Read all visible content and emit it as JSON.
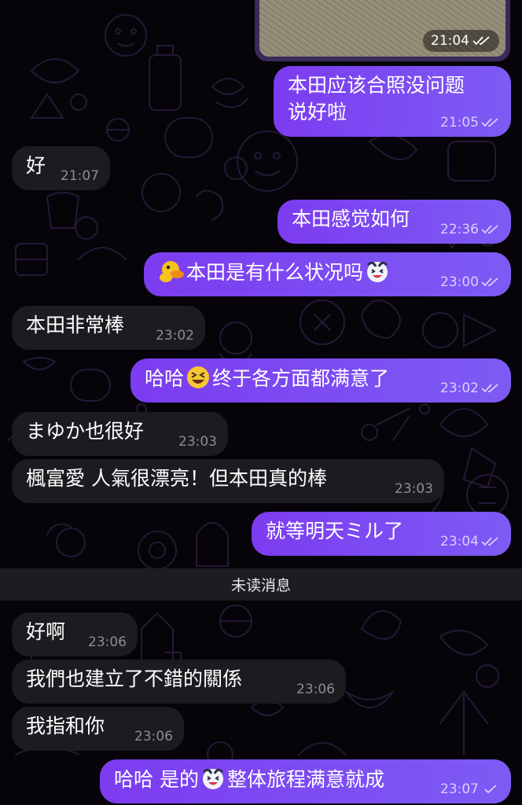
{
  "chat": {
    "photo_time": "21:04",
    "unread_divider": "未读消息",
    "messages": [
      {
        "id": "m1",
        "dir": "out",
        "lines": [
          "本田应该合照没问题",
          "说好啦"
        ],
        "time": "21:05",
        "status": "read"
      },
      {
        "id": "m2",
        "dir": "in",
        "text": "好",
        "time": "21:07"
      },
      {
        "id": "m3",
        "dir": "out",
        "text": "本田感觉如何",
        "time": "22:36",
        "status": "read"
      },
      {
        "id": "m4",
        "dir": "out",
        "emoji_start": "duck-emoji",
        "text": "本田是有什么状况吗",
        "emoji_end": "laughing-face-emoji",
        "time": "23:00",
        "status": "read"
      },
      {
        "id": "m5",
        "dir": "in",
        "text": "本田非常棒",
        "time": "23:02"
      },
      {
        "id": "m6",
        "dir": "out",
        "text_before": "哈哈",
        "emoji_mid": "grinning-squinting-face-emoji",
        "text_after": "终于各方面都满意了",
        "time": "23:02",
        "status": "read"
      },
      {
        "id": "m7",
        "dir": "in",
        "text": "まゆか也很好",
        "time": "23:03"
      },
      {
        "id": "m8",
        "dir": "in",
        "text": "楓富愛 人氣很漂亮！但本田真的棒",
        "time": "23:03"
      },
      {
        "id": "m9",
        "dir": "out",
        "text": "就等明天ミル了",
        "time": "23:04",
        "status": "read"
      },
      {
        "id": "m10",
        "dir": "in",
        "text": "好啊",
        "time": "23:06"
      },
      {
        "id": "m11",
        "dir": "in",
        "text": "我們也建立了不錯的關係",
        "time": "23:06"
      },
      {
        "id": "m12",
        "dir": "in",
        "text": "我指和你",
        "time": "23:06"
      },
      {
        "id": "m13",
        "dir": "out",
        "text_before": "哈哈 是的",
        "emoji_mid": "laughing-face-emoji",
        "text_after": "整体旅程满意就成",
        "time": "23:07",
        "status": "sent"
      }
    ]
  },
  "colors": {
    "outgoing_bubble": "#7c3cf0",
    "incoming_bubble": "#1c1b20",
    "background": "#060409"
  }
}
